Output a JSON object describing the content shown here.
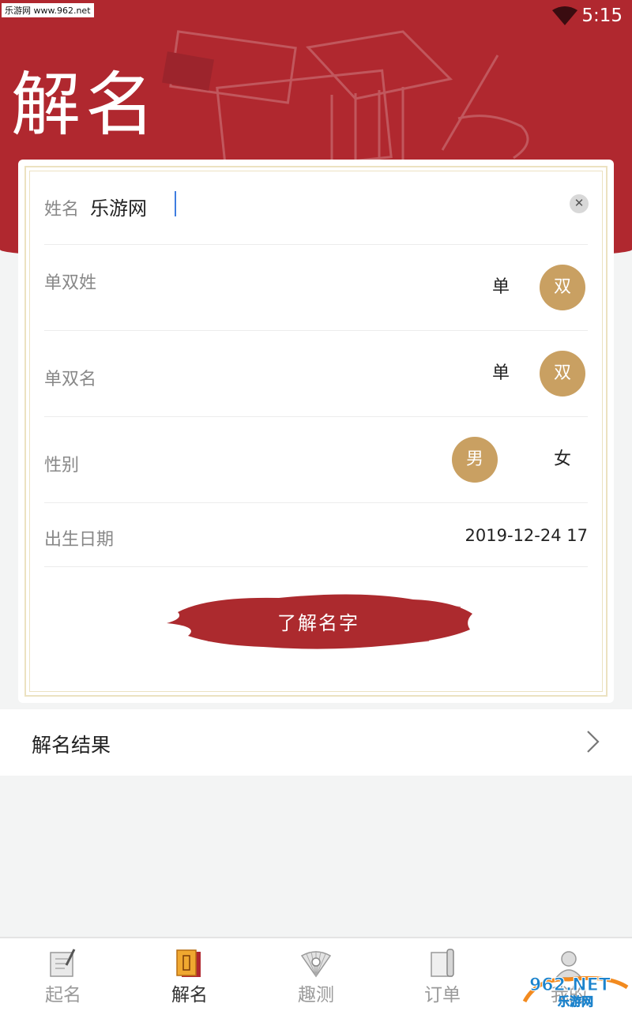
{
  "watermark": "乐游网 www.962.net",
  "status_bar": {
    "time": "5:15",
    "wifi_icon": "wifi-icon"
  },
  "header": {
    "title": "解名"
  },
  "form": {
    "name": {
      "label": "姓名",
      "value": "乐游网",
      "clear_icon": "clear-icon"
    },
    "surname_type": {
      "label": "单双姓",
      "options": [
        "单",
        "双"
      ],
      "selected": "双"
    },
    "given_name_type": {
      "label": "单双名",
      "options": [
        "单",
        "双"
      ],
      "selected": "双"
    },
    "gender": {
      "label": "性别",
      "options": [
        "男",
        "女"
      ],
      "selected": "男"
    },
    "birth_date": {
      "label": "出生日期",
      "value": "2019-12-24 17"
    },
    "submit_label": "了解名字"
  },
  "result_row": {
    "label": "解名结果",
    "chevron_icon": "chevron-right-icon"
  },
  "tabbar": {
    "tabs": [
      {
        "label": "起名",
        "icon": "calligraphy-icon",
        "active": false
      },
      {
        "label": "解名",
        "icon": "book-icon",
        "active": true
      },
      {
        "label": "趣测",
        "icon": "fan-icon",
        "active": false
      },
      {
        "label": "订单",
        "icon": "scroll-icon",
        "active": false
      },
      {
        "label": "我的",
        "icon": "profile-icon",
        "active": false
      }
    ]
  },
  "corner_logo": {
    "text_top": "962.NET",
    "text_bottom": "乐游网"
  },
  "colors": {
    "brand_red": "#b0282f",
    "selected_gold": "#c9a062",
    "frame_beige": "#ece2c1",
    "caret_blue": "#3f7de0"
  }
}
